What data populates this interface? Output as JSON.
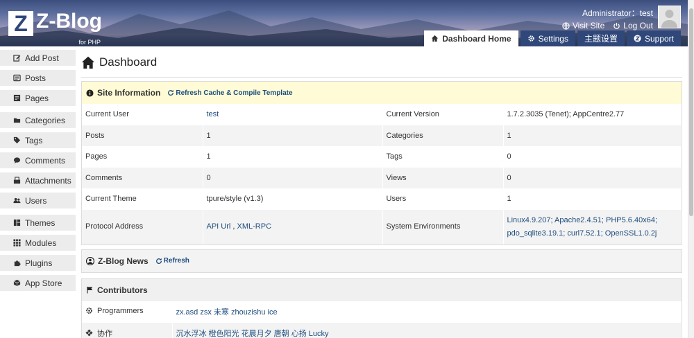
{
  "brand": {
    "logo_letter": "Z",
    "logo_text": "Z-Blog",
    "logo_sub": "for PHP"
  },
  "user": {
    "name": "Administrator：test",
    "visit_site": "Visit Site",
    "log_out": "Log Out"
  },
  "topnav": [
    {
      "label": "Dashboard Home",
      "icon": "home-icon",
      "active": true
    },
    {
      "label": "Settings",
      "icon": "gear-icon",
      "active": false
    },
    {
      "label": "主题设置",
      "icon": "",
      "active": false
    },
    {
      "label": "Support",
      "icon": "zblog-icon",
      "active": false
    }
  ],
  "sidebar": [
    {
      "label": "Add Post",
      "icon": "edit-icon"
    },
    {
      "label": "Posts",
      "icon": "posts-icon"
    },
    {
      "label": "Pages",
      "icon": "pages-icon"
    },
    {
      "label": "Categories",
      "icon": "folder-icon"
    },
    {
      "label": "Tags",
      "icon": "tag-icon"
    },
    {
      "label": "Comments",
      "icon": "comment-icon"
    },
    {
      "label": "Attachments",
      "icon": "attachment-icon"
    },
    {
      "label": "Users",
      "icon": "users-icon"
    },
    {
      "label": "Themes",
      "icon": "themes-icon"
    },
    {
      "label": "Modules",
      "icon": "modules-icon"
    },
    {
      "label": "Plugins",
      "icon": "plugin-icon"
    },
    {
      "label": "App Store",
      "icon": "appstore-icon"
    }
  ],
  "page": {
    "title": "Dashboard"
  },
  "site_info": {
    "title": "Site Information",
    "refresh_link": "Refresh Cache & Compile Template",
    "rows": [
      [
        "Current User",
        "test",
        "Current Version",
        "1.7.2.3035 (Tenet); AppCentre2.77"
      ],
      [
        "Posts",
        "1",
        "Categories",
        "1"
      ],
      [
        "Pages",
        "1",
        "Tags",
        "0"
      ],
      [
        "Comments",
        "0",
        "Views",
        "0"
      ],
      [
        "Current Theme",
        "tpure/style (v1.3)",
        "Users",
        "1"
      ]
    ],
    "protocol": {
      "label": "Protocol Address",
      "api": "API Url",
      "sep": " , ",
      "xmlrpc": "XML-RPC",
      "env_label": "System Environments",
      "env_line1": "Linux4.9.207; Apache2.4.51; PHP5.6.40x64;",
      "env_line2": "pdo_sqlite3.19.1; curl7.52.1; OpenSSL1.0.2j"
    }
  },
  "news": {
    "title": "Z-Blog News",
    "refresh": "Refresh"
  },
  "contributors": {
    "title": "Contributors",
    "rows": [
      {
        "label": "Programmers",
        "icon": "gear-icon",
        "value": "zx.asd zsx 未寒 zhouzishu ice"
      },
      {
        "label": "协作",
        "icon": "puzzle-icon",
        "value": "沉水浮冰 橙色阳光 花晨月夕 唐朝 心扬 Lucky"
      }
    ]
  },
  "colors": {
    "accent": "#2f4779",
    "link": "#1d4c7d",
    "info_bg": "#fefbd6",
    "sidebar_bg": "#ececec"
  }
}
